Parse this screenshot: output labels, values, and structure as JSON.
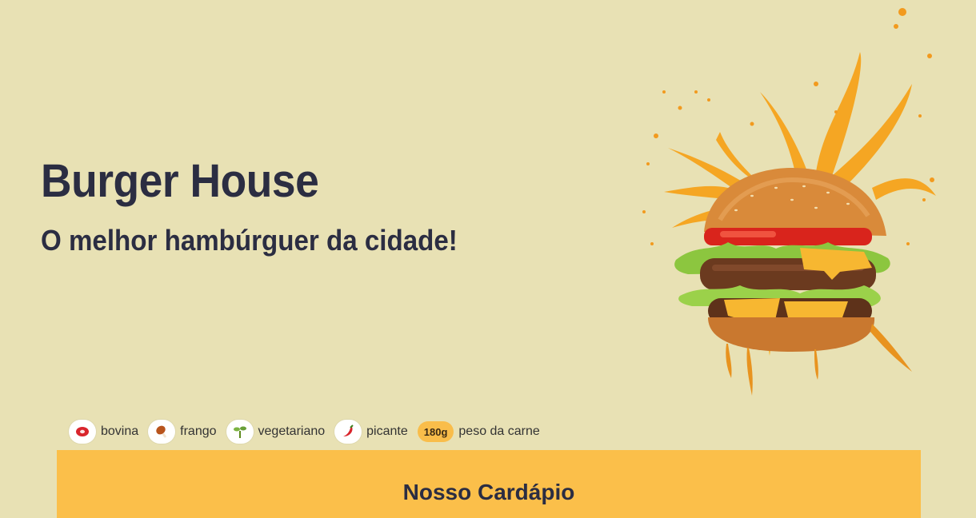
{
  "hero": {
    "title": "Burger House",
    "tagline": "O melhor hambúrguer da cidade!"
  },
  "legend": {
    "items": [
      {
        "icon": "beef-icon",
        "label": "bovina"
      },
      {
        "icon": "chicken-leg-icon",
        "label": "frango"
      },
      {
        "icon": "sprout-icon",
        "label": "vegetariano"
      },
      {
        "icon": "chili-pepper-icon",
        "label": "picante"
      }
    ],
    "weight_badge": "180g",
    "weight_label": "peso da carne"
  },
  "menu": {
    "title": "Nosso Cardápio"
  },
  "colors": {
    "background": "#e8e1b4",
    "accent": "#fbbf4a",
    "text": "#2b2d42"
  }
}
